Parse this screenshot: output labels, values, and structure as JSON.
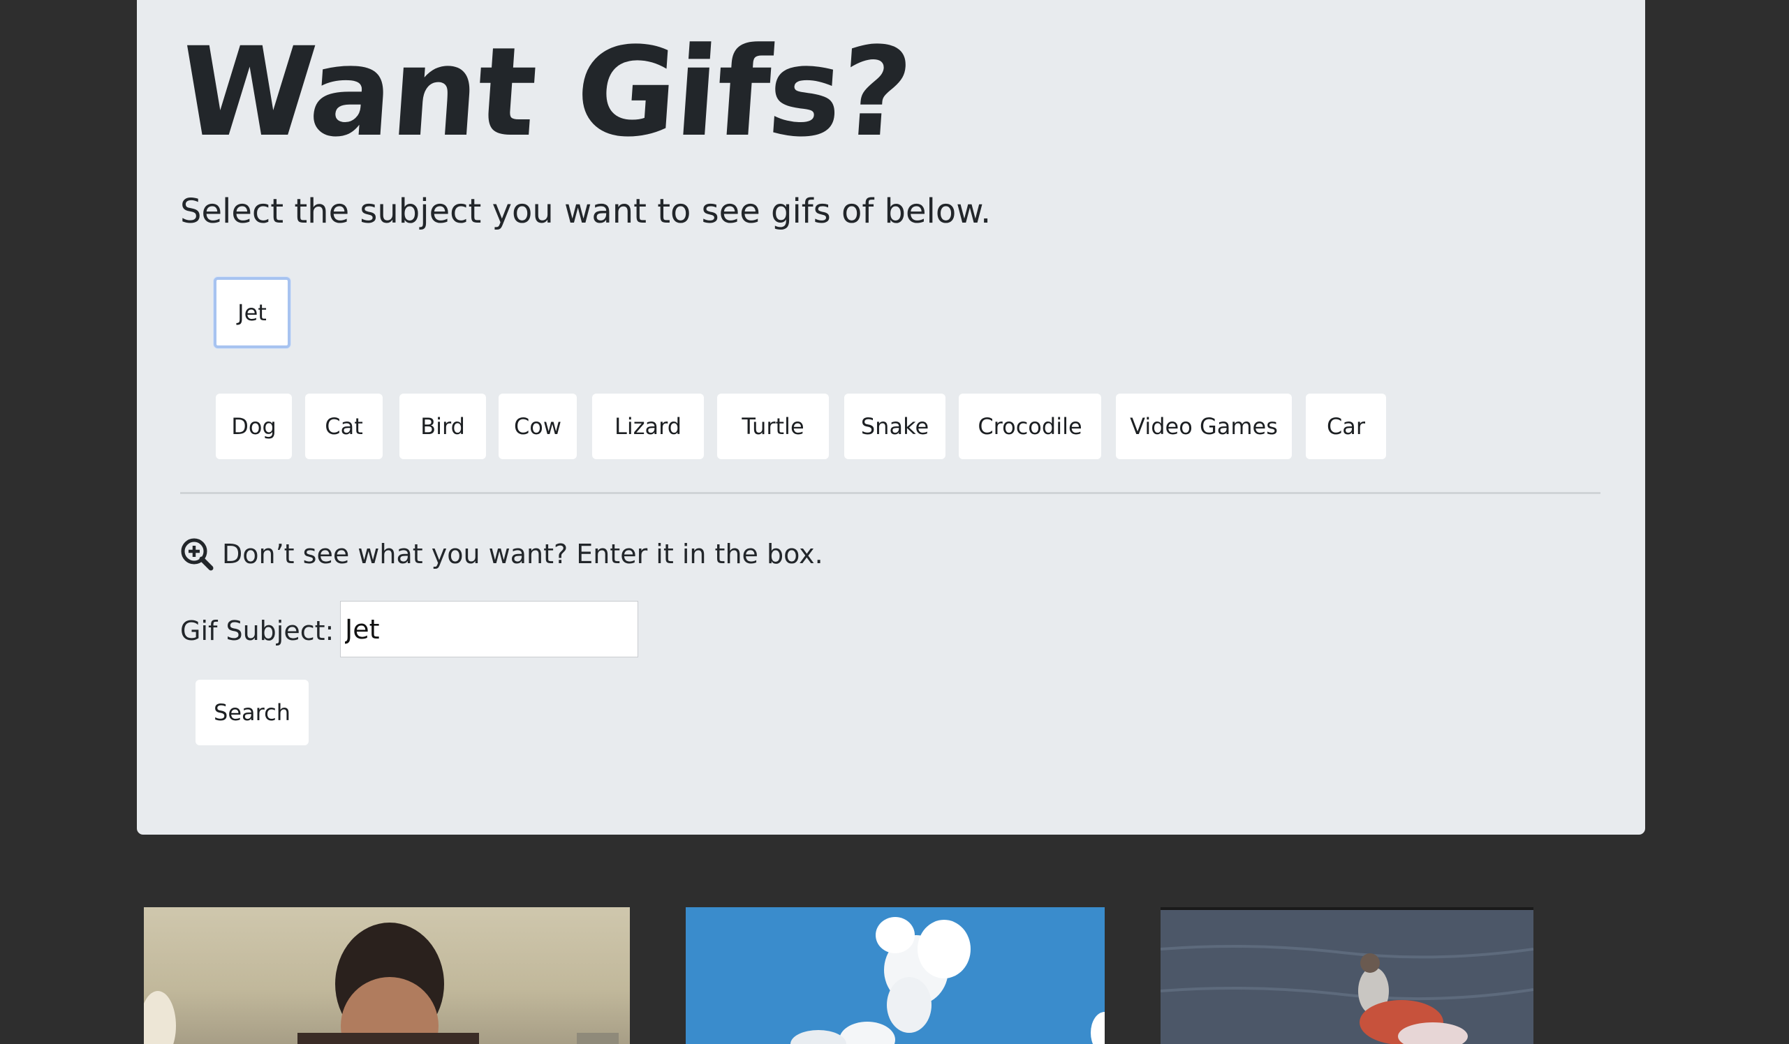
{
  "header": {
    "title": "Want Gifs?",
    "lead": "Select the subject you want to see gifs of below."
  },
  "active_topic": {
    "label": "Jet"
  },
  "topics": [
    {
      "label": "Dog"
    },
    {
      "label": "Cat"
    },
    {
      "label": "Bird"
    },
    {
      "label": "Cow"
    },
    {
      "label": "Lizard"
    },
    {
      "label": "Turtle"
    },
    {
      "label": "Snake"
    },
    {
      "label": "Crocodile"
    },
    {
      "label": "Video Games"
    },
    {
      "label": "Car"
    }
  ],
  "search": {
    "hint": "Don’t see what you want? Enter it in the box.",
    "hint_icon": "zoom-in-icon",
    "label": "Gif Subject:",
    "value": "Jet",
    "button_label": "Search"
  },
  "colors": {
    "page_background": "#2e2e2e",
    "panel_background": "#e8ebee",
    "text": "#22262a",
    "active_border": "#a7c3f0"
  }
}
